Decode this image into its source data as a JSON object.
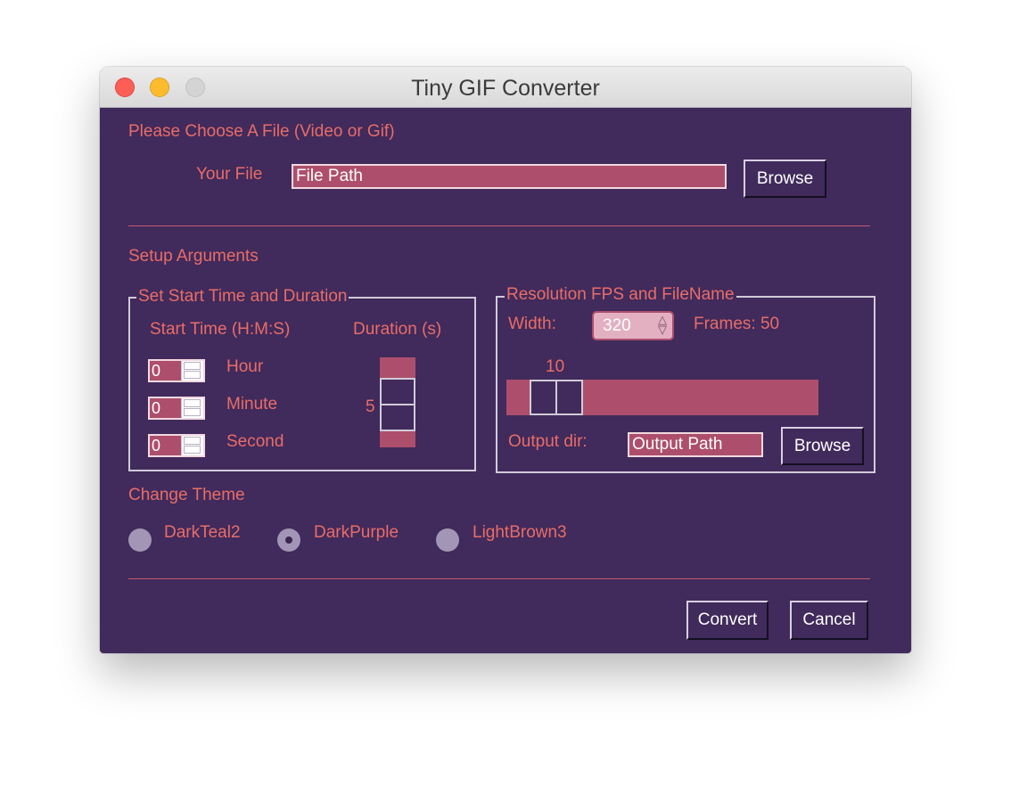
{
  "window": {
    "title": "Tiny GIF Converter"
  },
  "file": {
    "heading": "Please Choose A File (Video or Gif)",
    "label": "Your File",
    "value": "File Path",
    "browse": "Browse"
  },
  "separator": "______________________________________________________________",
  "setup": {
    "heading": "Setup Arguments"
  },
  "time": {
    "legend": "Set Start Time and Duration",
    "start_label": "Start Time (H:M:S)",
    "duration_label": "Duration (s)",
    "hour": {
      "value": "0",
      "label": "Hour"
    },
    "minute": {
      "value": "0",
      "label": "Minute"
    },
    "second": {
      "value": "0",
      "label": "Second"
    },
    "duration_value": "5"
  },
  "resolution": {
    "legend": "Resolution FPS and FileName",
    "width_label": "Width:",
    "width_value": "320",
    "frames_label": "Frames: 50",
    "fps_value": "10",
    "output_label": "Output dir:",
    "output_value": "Output Path",
    "browse": "Browse"
  },
  "theme": {
    "heading": "Change Theme",
    "options": [
      {
        "label": "DarkTeal2",
        "checked": false
      },
      {
        "label": "DarkPurple",
        "checked": true
      },
      {
        "label": "LightBrown3",
        "checked": false
      }
    ]
  },
  "actions": {
    "convert": "Convert",
    "cancel": "Cancel"
  },
  "colors": {
    "background": "#412a5c",
    "text": "#e86d67",
    "input": "#ad4f6c",
    "button_text": "#ffffff"
  }
}
